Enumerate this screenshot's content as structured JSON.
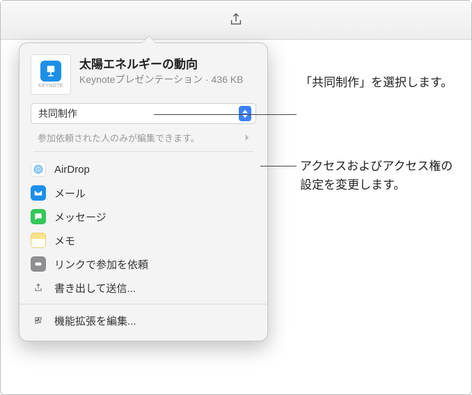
{
  "toolbar": {
    "share_label": ""
  },
  "popover": {
    "title": "太陽エネルギーの動向",
    "subtitle": "Keynoteプレゼンテーション · 436 KB",
    "file_badge": "KEYNOTE",
    "mode_select": {
      "value": "共同制作"
    },
    "access_row": {
      "text": "参加依頼された人のみが編集できます。"
    },
    "share_options": [
      {
        "icon": "airdrop",
        "label": "AirDrop"
      },
      {
        "icon": "mail",
        "label": "メール"
      },
      {
        "icon": "messages",
        "label": "メッセージ"
      },
      {
        "icon": "notes",
        "label": "メモ"
      },
      {
        "icon": "link",
        "label": "リンクで参加を依頼"
      },
      {
        "icon": "export",
        "label": "書き出して送信..."
      }
    ],
    "extensions": {
      "label": "機能拡張を編集..."
    }
  },
  "callouts": {
    "c1": "「共同制作」を選択します。",
    "c2": "アクセスおよびアクセス権の設定を変更します。"
  }
}
